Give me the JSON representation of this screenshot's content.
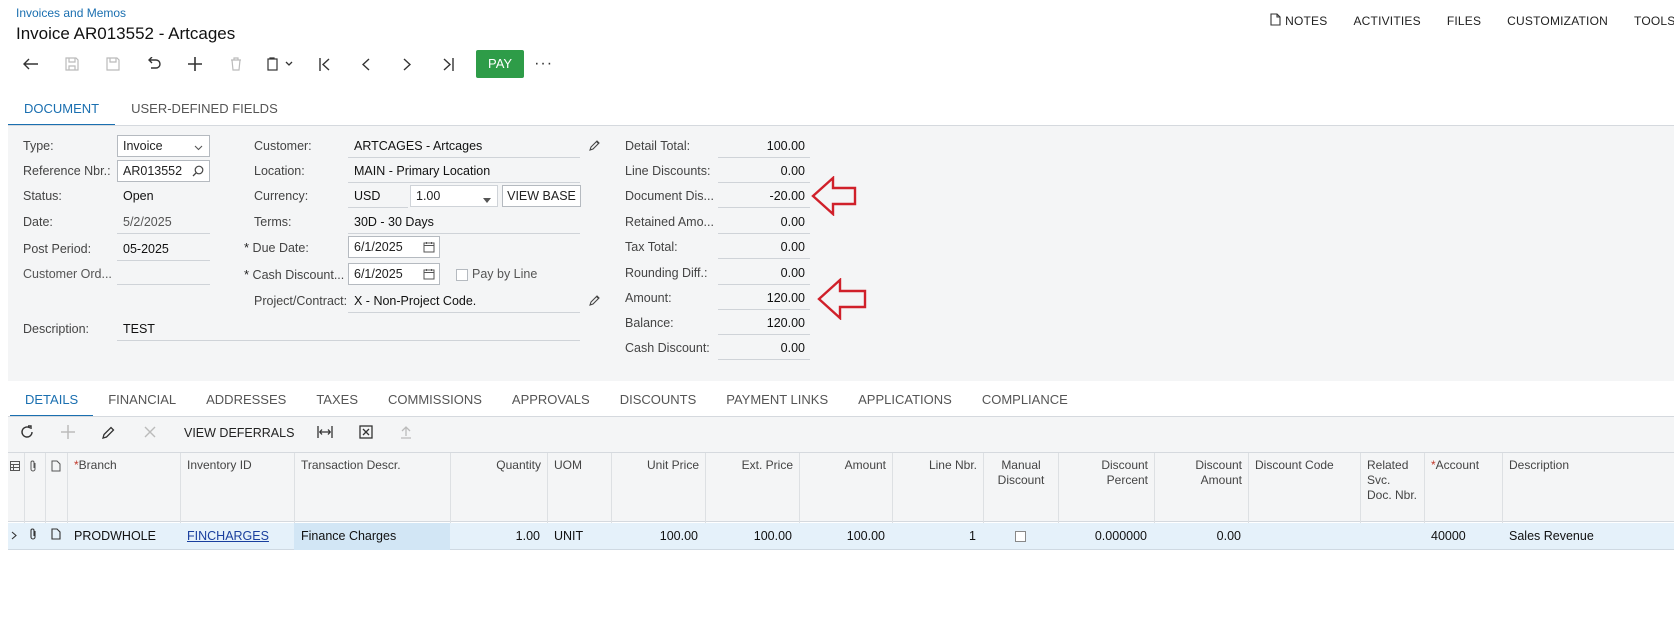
{
  "breadcrumb": "Invoices and Memos",
  "title": "Invoice AR013552 - Artcages",
  "topbar": {
    "notes": "NOTES",
    "activities": "ACTIVITIES",
    "files": "FILES",
    "customization": "CUSTOMIZATION",
    "tools": "TOOLS"
  },
  "toolbar": {
    "pay": "PAY",
    "more": "···"
  },
  "doc_tabs": [
    "DOCUMENT",
    "USER-DEFINED FIELDS"
  ],
  "form": {
    "type_label": "Type:",
    "type_value": "Invoice",
    "ref_label": "Reference Nbr.:",
    "ref_value": "AR013552",
    "status_label": "Status:",
    "status_value": "Open",
    "date_label": "Date:",
    "date_value": "5/2/2025",
    "post_label": "Post Period:",
    "post_value": "05-2025",
    "custord_label": "Customer Ord...",
    "custord_value": "",
    "desc_label": "Description:",
    "desc_value": "TEST",
    "customer_label": "Customer:",
    "customer_value": "ARTCAGES - Artcages",
    "location_label": "Location:",
    "location_value": "MAIN - Primary Location",
    "currency_label": "Currency:",
    "currency_value": "USD",
    "rate_value": "1.00",
    "view_base": "VIEW BASE",
    "terms_label": "Terms:",
    "terms_value": "30D - 30 Days",
    "due_label": "Due Date:",
    "due_value": "6/1/2025",
    "cashdisc_label": "Cash Discount...",
    "cashdisc_value": "6/1/2025",
    "paybyline_label": "Pay by Line",
    "project_label": "Project/Contract:",
    "project_value": "X - Non-Project Code.",
    "req_mark": "*"
  },
  "totals": [
    {
      "label": "Detail Total:",
      "value": "100.00"
    },
    {
      "label": "Line Discounts:",
      "value": "0.00"
    },
    {
      "label": "Document Dis...",
      "value": "-20.00"
    },
    {
      "label": "Retained Amo...",
      "value": "0.00"
    },
    {
      "label": "Tax Total:",
      "value": "0.00"
    },
    {
      "label": "Rounding Diff.:",
      "value": "0.00"
    },
    {
      "label": "Amount:",
      "value": "120.00"
    },
    {
      "label": "Balance:",
      "value": "120.00"
    },
    {
      "label": "Cash Discount:",
      "value": "0.00"
    }
  ],
  "detail_tabs": [
    "DETAILS",
    "FINANCIAL",
    "ADDRESSES",
    "TAXES",
    "COMMISSIONS",
    "APPROVALS",
    "DISCOUNTS",
    "PAYMENT LINKS",
    "APPLICATIONS",
    "COMPLIANCE"
  ],
  "grid_toolbar": {
    "view_deferrals": "VIEW DEFERRALS"
  },
  "grid_headers": {
    "branch": "Branch",
    "inventory": "Inventory ID",
    "trandesc": "Transaction Descr.",
    "qty": "Quantity",
    "uom": "UOM",
    "unitprice": "Unit Price",
    "extprice": "Ext. Price",
    "amount": "Amount",
    "linenbr": "Line Nbr.",
    "manualdisc": "Manual Discount",
    "discpct": "Discount Percent",
    "discamt": "Discount Amount",
    "disccode": "Discount Code",
    "related": "Related Svc. Doc. Nbr.",
    "account": "Account",
    "description": "Description"
  },
  "grid_row": {
    "branch": "PRODWHOLE",
    "inventory": "FINCHARGES",
    "trandesc": "Finance Charges",
    "qty": "1.00",
    "uom": "UNIT",
    "unitprice": "100.00",
    "extprice": "100.00",
    "amount": "100.00",
    "linenbr": "1",
    "discpct": "0.000000",
    "discamt": "0.00",
    "disccode": "",
    "related": "",
    "account": "40000",
    "description": "Sales Revenue"
  },
  "colors": {
    "accent": "#1a6fb0",
    "pay": "#2e9c48",
    "arrow": "#d0202a"
  }
}
